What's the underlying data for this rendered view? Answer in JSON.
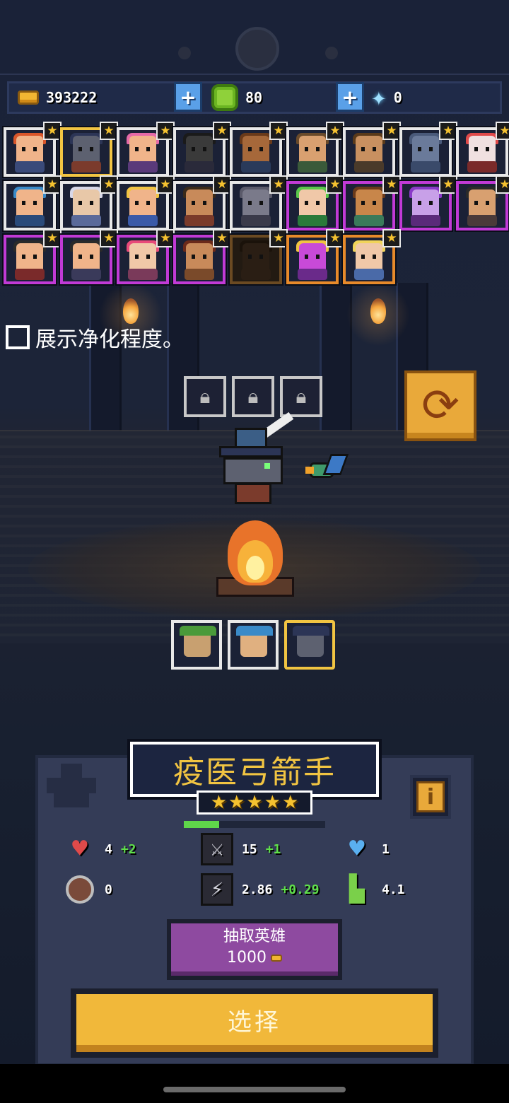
{
  "resources": {
    "gold": "393222",
    "gems": "80",
    "crystals": "0"
  },
  "hero_rows": [
    [
      {
        "name": "hero-red-hair",
        "frame": "white",
        "skin": "#f0b48a",
        "hair": "#d9562a",
        "body": "#3a4a7a"
      },
      {
        "name": "hero-plague-doctor",
        "frame": "gold",
        "skin": "#5d6170",
        "hair": "#2c3556",
        "body": "#7b3b2c"
      },
      {
        "name": "hero-pink-hair",
        "frame": "white",
        "skin": "#f0b48a",
        "hair": "#e56aa8",
        "body": "#5a3a7a"
      },
      {
        "name": "hero-witch",
        "frame": "white",
        "skin": "#3a3a3a",
        "hair": "#1a1a1a",
        "body": "#2a2a3a"
      },
      {
        "name": "hero-monk",
        "frame": "white",
        "skin": "#a6683a",
        "hair": "#6a3a1a",
        "body": "#2a3a5a"
      },
      {
        "name": "hero-ranger",
        "frame": "white",
        "skin": "#d9a070",
        "hair": "#6a4a2a",
        "body": "#3a5a3a"
      },
      {
        "name": "hero-bearded",
        "frame": "white",
        "skin": "#c89060",
        "hair": "#5a3a1a",
        "body": "#4a3a2a"
      },
      {
        "name": "hero-golem",
        "frame": "white",
        "skin": "#6a7a9a",
        "hair": "#4a5a7a",
        "body": "#3a4a6a"
      },
      {
        "name": "hero-fox",
        "frame": "white",
        "skin": "#f0e0e0",
        "hair": "#e04a4a",
        "body": "#7a2a2a"
      }
    ],
    [
      {
        "name": "hero-blue-cap",
        "frame": "white",
        "skin": "#f0b48a",
        "hair": "#3a8ac8",
        "body": "#2a4a7a"
      },
      {
        "name": "hero-old-man",
        "frame": "white",
        "skin": "#e8c8a8",
        "hair": "#d8d8e8",
        "body": "#5a6a9a"
      },
      {
        "name": "hero-king",
        "frame": "white",
        "skin": "#f0b48a",
        "hair": "#f1c442",
        "body": "#3a5aa8"
      },
      {
        "name": "hero-brawler",
        "frame": "white",
        "skin": "#c88a5a",
        "hair": "#3a2a1a",
        "body": "#7a3a2a"
      },
      {
        "name": "hero-wolf",
        "frame": "white",
        "skin": "#7a7a8a",
        "hair": "#5a5a6a",
        "body": "#3a3a4a"
      },
      {
        "name": "hero-dryad",
        "frame": "purple",
        "skin": "#f0c8a8",
        "hair": "#5ac84a",
        "body": "#2a7a3a"
      },
      {
        "name": "hero-big-guy",
        "frame": "purple",
        "skin": "#c8864a",
        "hair": "#6a3a1a",
        "body": "#3a7a5a"
      },
      {
        "name": "hero-sorcerer",
        "frame": "purple",
        "skin": "#c8a0e8",
        "hair": "#8a3ac8",
        "body": "#5a2a7a"
      },
      {
        "name": "hero-rogue",
        "frame": "purple",
        "skin": "#d8a070",
        "hair": "#2a2a2a",
        "body": "#4a3a3a"
      }
    ],
    [
      {
        "name": "hero-hat-gunner",
        "frame": "purple",
        "skin": "#f0b48a",
        "hair": "#2a2a2a",
        "body": "#7a2a2a"
      },
      {
        "name": "hero-swordsman",
        "frame": "purple",
        "skin": "#f0b48a",
        "hair": "#2a2a2a",
        "body": "#3a3a5a"
      },
      {
        "name": "hero-pink-twin",
        "frame": "purple",
        "skin": "#f0c8a8",
        "hair": "#e84a7a",
        "body": "#7a3a5a"
      },
      {
        "name": "hero-pirate",
        "frame": "purple",
        "skin": "#c88a5a",
        "hair": "#6a2a1a",
        "body": "#7a4a2a"
      },
      {
        "name": "hero-shadow",
        "frame": "dark",
        "skin": "#2a1e14",
        "hair": "#1a120a",
        "body": "#2a1e14"
      },
      {
        "name": "hero-demon",
        "frame": "orange",
        "skin": "#c84ad8",
        "hair": "#f1c442",
        "body": "#6a2a8a"
      },
      {
        "name": "hero-blonde",
        "frame": "orange",
        "skin": "#f0c8a8",
        "hair": "#f1d45a",
        "body": "#4a6aa8"
      }
    ]
  ],
  "purify_label": "展示净化程度。",
  "team": [
    {
      "name": "team-slot-green-hat",
      "hat": "#4a9a3a",
      "face": "#c8a070",
      "selected": false
    },
    {
      "name": "team-slot-blue-hat",
      "hat": "#3a8ac8",
      "face": "#e0b080",
      "selected": false
    },
    {
      "name": "team-slot-plague-doctor",
      "hat": "#2c3556",
      "face": "#5d6170",
      "selected": true
    }
  ],
  "hero_panel": {
    "name": "疫医弓箭手",
    "stars": 5,
    "xp_fraction": 0.25,
    "stats": {
      "hp": "4",
      "hp_bonus": "+2",
      "attack": "15",
      "attack_bonus": "+1",
      "shield": "1",
      "armor": "0",
      "attack_speed": "2.86",
      "attack_speed_bonus": "+0.29",
      "move_speed": "4.1"
    }
  },
  "draw_button": {
    "label": "抽取英雄",
    "cost": "1000"
  },
  "select_button": {
    "label": "选择"
  },
  "colors": {
    "gold": "#f1c442",
    "panel": "#343c57",
    "purple_button": "#8e4aa0",
    "bonus_green": "#5fe04a"
  }
}
